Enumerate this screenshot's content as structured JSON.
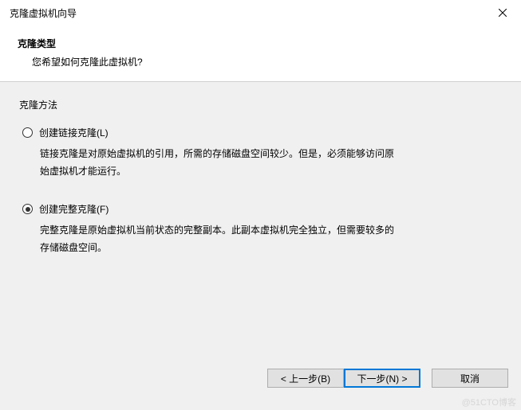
{
  "titlebar": {
    "title": "克隆虚拟机向导"
  },
  "header": {
    "title": "克隆类型",
    "subtitle": "您希望如何克隆此虚拟机?"
  },
  "content": {
    "section_label": "克隆方法",
    "options": [
      {
        "label": "创建链接克隆(L)",
        "description": "链接克隆是对原始虚拟机的引用，所需的存储磁盘空间较少。但是，必须能够访问原始虚拟机才能运行。",
        "selected": false
      },
      {
        "label": "创建完整克隆(F)",
        "description": "完整克隆是原始虚拟机当前状态的完整副本。此副本虚拟机完全独立，但需要较多的存储磁盘空间。",
        "selected": true
      }
    ]
  },
  "buttons": {
    "back": "< 上一步(B)",
    "next": "下一步(N) >",
    "cancel": "取消"
  },
  "watermark": "@51CTO博客"
}
